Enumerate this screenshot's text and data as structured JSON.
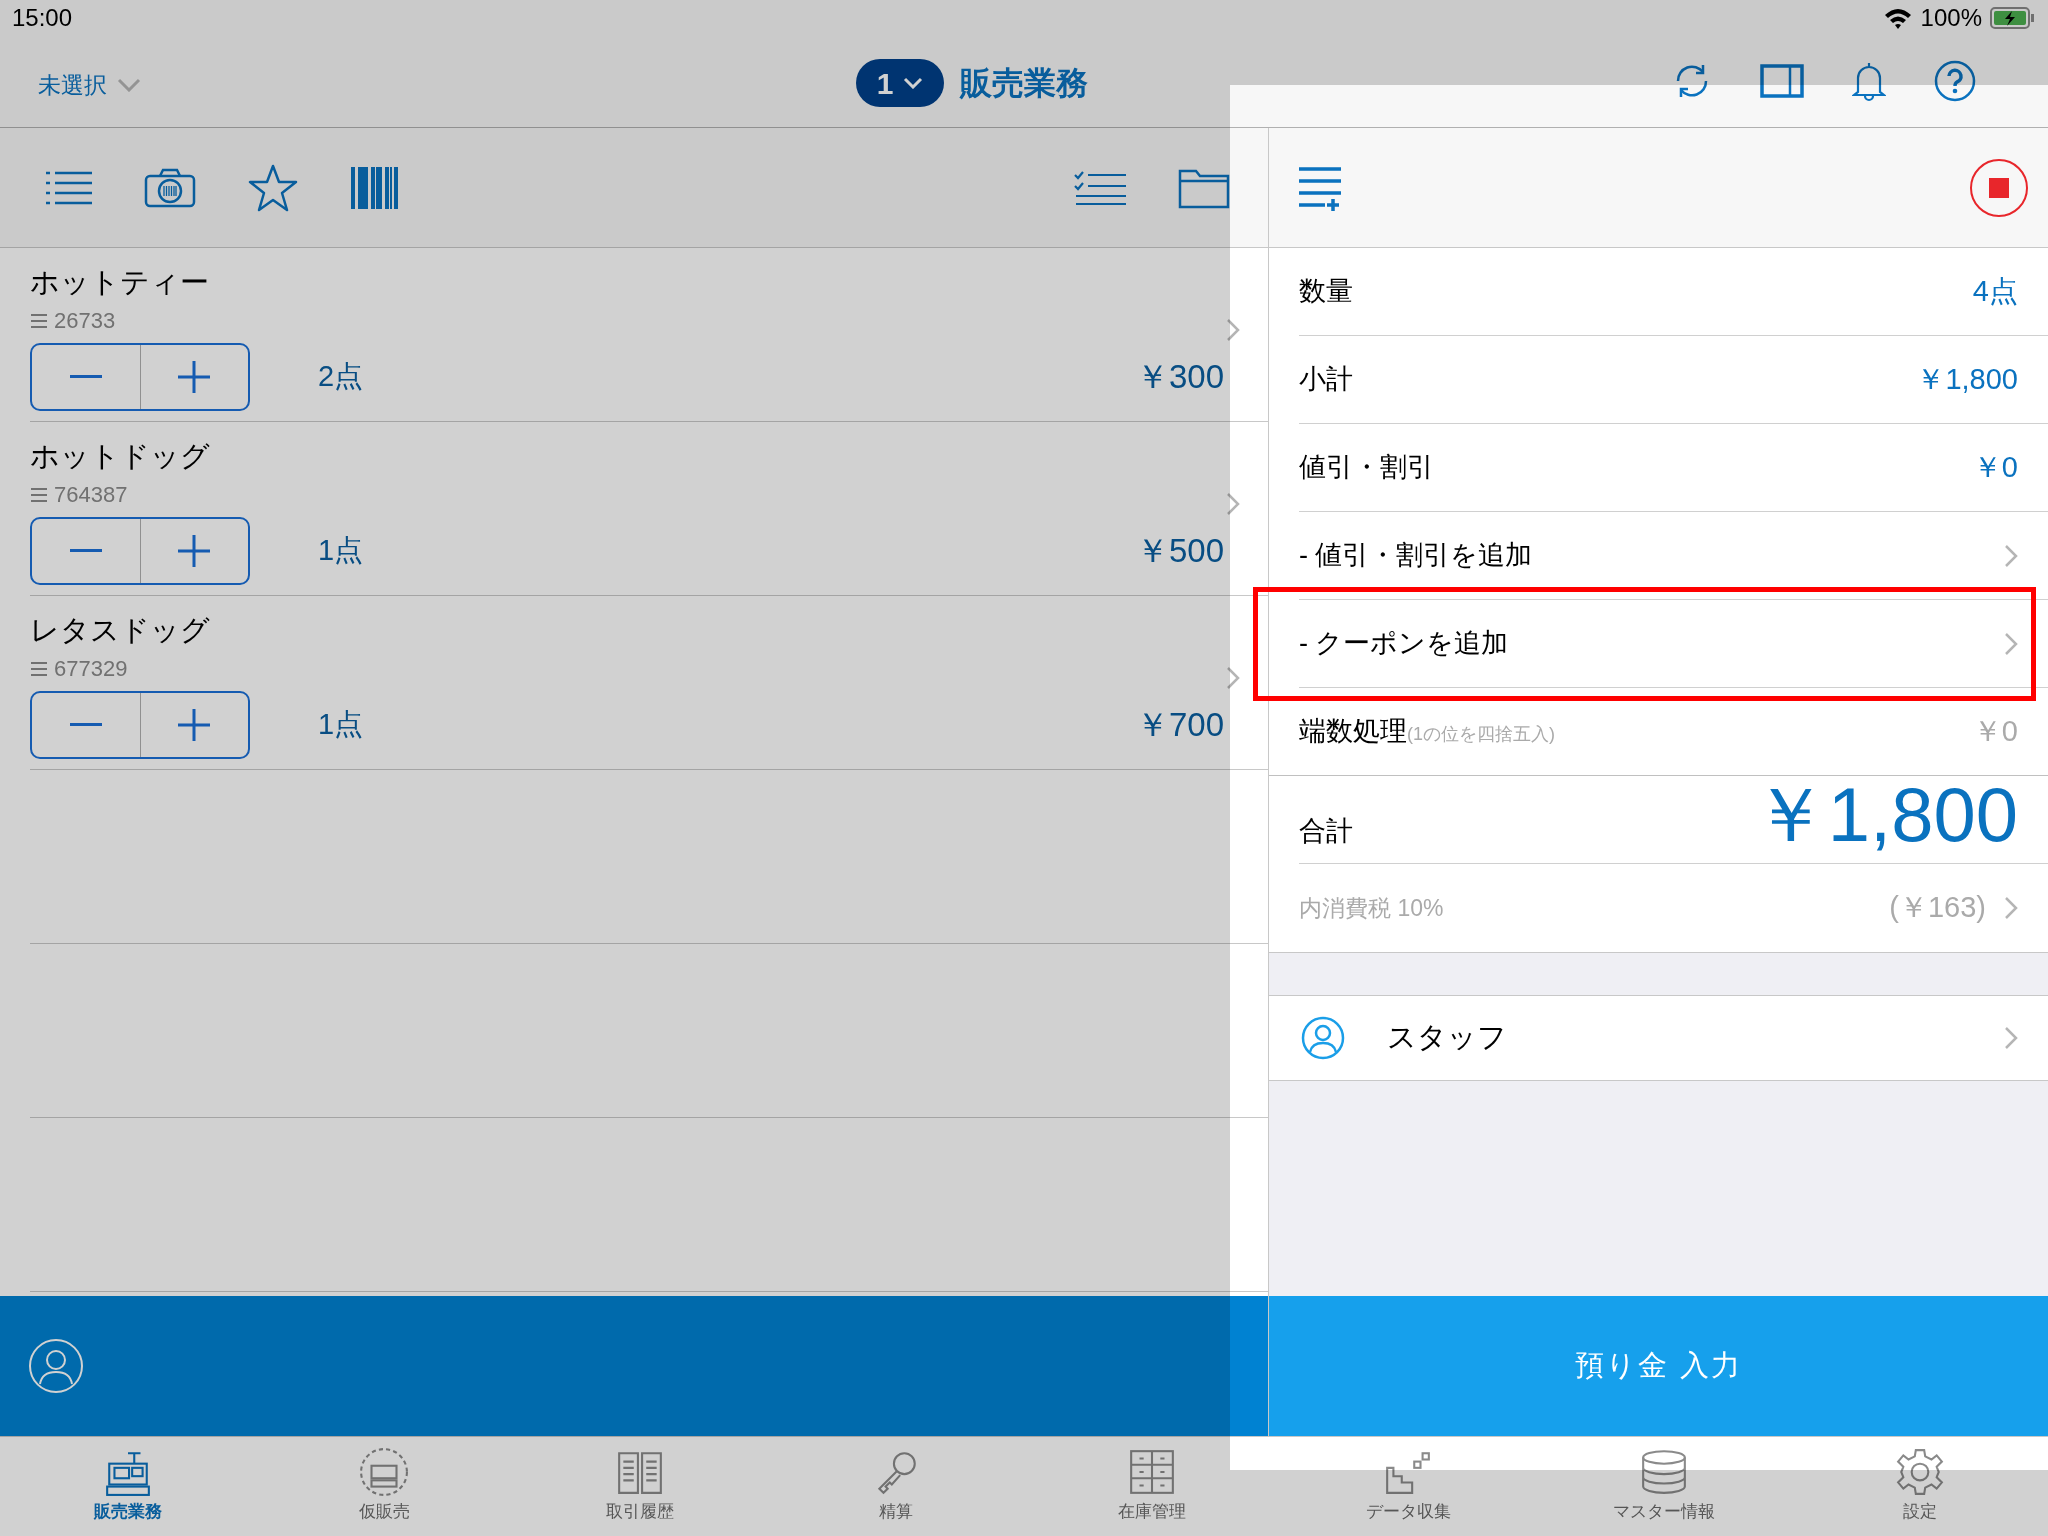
{
  "status_bar": {
    "time": "15:00",
    "battery": "100%"
  },
  "nav": {
    "store": "未選択",
    "register": "1",
    "title": "販売業務"
  },
  "items": [
    {
      "name": "ホットティー",
      "code": "26733",
      "quantity": "2点",
      "price": "￥300"
    },
    {
      "name": "ホットドッグ",
      "code": "764387",
      "quantity": "1点",
      "price": "￥500"
    },
    {
      "name": "レタスドッグ",
      "code": "677329",
      "quantity": "1点",
      "price": "￥700"
    }
  ],
  "summary": [
    {
      "kind": "value",
      "label": "数量",
      "value": "4点",
      "highlighted": false
    },
    {
      "kind": "value",
      "label": "小計",
      "value": "￥1,800",
      "highlighted": false
    },
    {
      "kind": "value",
      "label": "値引・割引",
      "value": "￥0",
      "highlighted": false
    },
    {
      "kind": "link",
      "label": "- 値引・割引を追加",
      "highlighted": false
    },
    {
      "kind": "link",
      "label": "- クーポンを追加",
      "highlighted": true
    },
    {
      "kind": "rounding",
      "label": "端数処理",
      "note": "(1の位を四捨五入)",
      "value": "￥0",
      "highlighted": false
    },
    {
      "kind": "total",
      "label": "合計",
      "value": "￥1,800",
      "highlighted": false
    },
    {
      "kind": "tax",
      "label": "内消費税 10%",
      "value": "(￥163)",
      "highlighted": false
    }
  ],
  "staff": {
    "label": "スタッフ"
  },
  "deposit_button": "預り金 入力",
  "tabs": [
    {
      "label": "販売業務",
      "selected": true
    },
    {
      "label": "仮販売",
      "selected": false
    },
    {
      "label": "取引履歴",
      "selected": false
    },
    {
      "label": "精算",
      "selected": false
    },
    {
      "label": "在庫管理",
      "selected": false
    },
    {
      "label": "データ収集",
      "selected": false
    },
    {
      "label": "マスター情報",
      "selected": false
    },
    {
      "label": "設定",
      "selected": false
    }
  ]
}
